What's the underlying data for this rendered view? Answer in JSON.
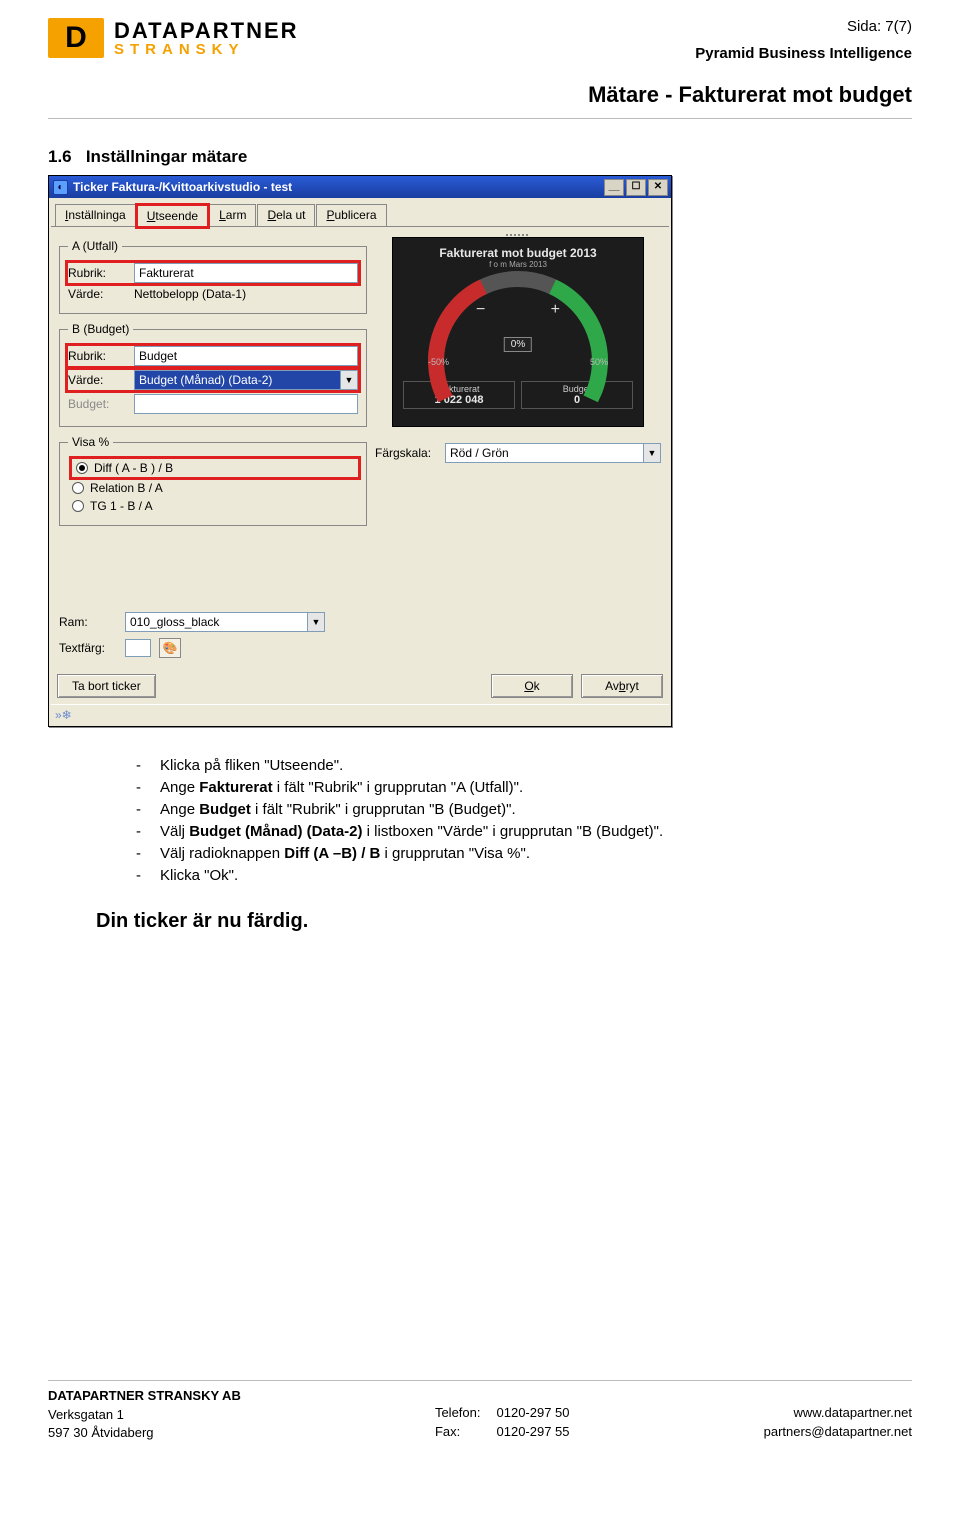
{
  "header": {
    "page_label": "Sida: 7(7)",
    "bi_line": "Pyramid Business Intelligence",
    "doc_title": "Mätare - Fakturerat mot budget",
    "logo_top": "DATAPARTNER",
    "logo_sub": "STRANSKY",
    "logo_mark": "D"
  },
  "section": {
    "num": "1.6",
    "title": "Inställningar mätare"
  },
  "window": {
    "title": "Ticker Faktura-/Kvittoarkivstudio - test",
    "tabs": {
      "installningar": "Inställninga",
      "installningar_ul": "I",
      "utseende": "Utseende",
      "utseende_ul": "U",
      "larm": "Larm",
      "larm_ul": "L",
      "delaut": "Dela ut",
      "delaut_ul": "D",
      "publicera": "Publicera",
      "publicera_ul": "P"
    },
    "groupA": {
      "legend": "A (Utfall)",
      "rubrik_label": "Rubrik:",
      "rubrik_value": "Fakturerat",
      "varde_label": "Värde:",
      "varde_value": "Nettobelopp (Data-1)"
    },
    "groupB": {
      "legend": "B (Budget)",
      "rubrik_label": "Rubrik:",
      "rubrik_value": "Budget",
      "varde_label": "Värde:",
      "varde_value": "Budget (Månad) (Data-2)",
      "budget_label": "Budget:",
      "budget_value": ""
    },
    "visa": {
      "legend": "Visa %",
      "diff_label": "Diff    ( A - B ) / B",
      "relation_label": "Relation   B / A",
      "tg_label": "TG    1 - B / A"
    },
    "gauge": {
      "title": "Fakturerat mot budget 2013",
      "subtitle": "f o m Mars 2013",
      "minus": "−",
      "plus": "+",
      "left50": "-50%",
      "right50": "50%",
      "readout": "0%",
      "info1_key": "Fakturerat",
      "info1_val": "1 022 048",
      "info2_key": "Budget",
      "info2_val": "0",
      "scale_label": "Färgskala:",
      "scale_value": "Röd / Grön"
    },
    "lower": {
      "ram_label": "Ram:",
      "ram_value": "010_gloss_black",
      "textfarg_label": "Textfärg:"
    },
    "buttons": {
      "remove": "Ta bort ticker",
      "ok": "Ok",
      "ok_ul": "O",
      "cancel": "Avbryt",
      "cancel_ul": "b"
    }
  },
  "instructions": [
    "Klicka på fliken \"Utseende\".",
    "Ange <b>Fakturerat</b> i fält \"Rubrik\" i grupprutan \"A (Utfall)\".",
    "Ange <b>Budget</b> i fält \"Rubrik\" i grupprutan \"B (Budget)\".",
    "Välj <b>Budget (Månad) (Data-2)</b> i listboxen \"Värde\" i grupprutan \"B (Budget)\".",
    "Välj radioknappen <b>Diff (A –B) / B</b> i grupprutan \"Visa %\".",
    "Klicka \"Ok\"."
  ],
  "done_line": "Din ticker är nu färdig.",
  "footer": {
    "company": "DATAPARTNER STRANSKY AB",
    "addr1": "Verksgatan 1",
    "addr2": "597 30 Åtvidaberg",
    "tel_label": "Telefon:",
    "tel": "0120-297 50",
    "fax_label": "Fax:",
    "fax": "0120-297 55",
    "url": "www.datapartner.net",
    "email": "partners@datapartner.net"
  }
}
